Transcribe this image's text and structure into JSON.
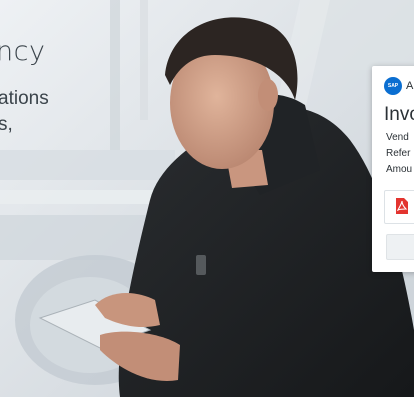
{
  "hero": {
    "headline": "ncy",
    "subline_1": "ations",
    "subline_2": "s,"
  },
  "card": {
    "logo_text": "SAP",
    "brand_fragment": "A",
    "title": "Invo",
    "fields": [
      "Vend",
      "Refer",
      "Amou"
    ],
    "attachment_icon": "pdf-icon",
    "accent_color": "#0a6ed1",
    "pdf_color": "#e3342f"
  }
}
